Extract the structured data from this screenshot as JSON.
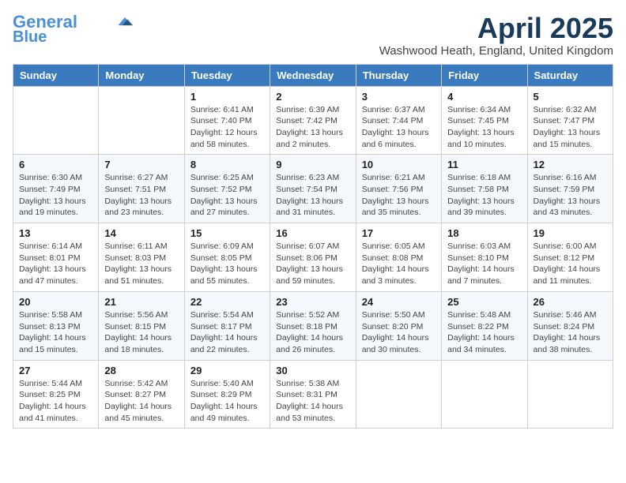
{
  "logo": {
    "line1": "General",
    "line2": "Blue",
    "icon_color": "#4a90d9"
  },
  "header": {
    "month": "April 2025",
    "location": "Washwood Heath, England, United Kingdom"
  },
  "weekdays": [
    "Sunday",
    "Monday",
    "Tuesday",
    "Wednesday",
    "Thursday",
    "Friday",
    "Saturday"
  ],
  "weeks": [
    [
      {
        "day": "",
        "info": ""
      },
      {
        "day": "",
        "info": ""
      },
      {
        "day": "1",
        "info": "Sunrise: 6:41 AM\nSunset: 7:40 PM\nDaylight: 12 hours and 58 minutes."
      },
      {
        "day": "2",
        "info": "Sunrise: 6:39 AM\nSunset: 7:42 PM\nDaylight: 13 hours and 2 minutes."
      },
      {
        "day": "3",
        "info": "Sunrise: 6:37 AM\nSunset: 7:44 PM\nDaylight: 13 hours and 6 minutes."
      },
      {
        "day": "4",
        "info": "Sunrise: 6:34 AM\nSunset: 7:45 PM\nDaylight: 13 hours and 10 minutes."
      },
      {
        "day": "5",
        "info": "Sunrise: 6:32 AM\nSunset: 7:47 PM\nDaylight: 13 hours and 15 minutes."
      }
    ],
    [
      {
        "day": "6",
        "info": "Sunrise: 6:30 AM\nSunset: 7:49 PM\nDaylight: 13 hours and 19 minutes."
      },
      {
        "day": "7",
        "info": "Sunrise: 6:27 AM\nSunset: 7:51 PM\nDaylight: 13 hours and 23 minutes."
      },
      {
        "day": "8",
        "info": "Sunrise: 6:25 AM\nSunset: 7:52 PM\nDaylight: 13 hours and 27 minutes."
      },
      {
        "day": "9",
        "info": "Sunrise: 6:23 AM\nSunset: 7:54 PM\nDaylight: 13 hours and 31 minutes."
      },
      {
        "day": "10",
        "info": "Sunrise: 6:21 AM\nSunset: 7:56 PM\nDaylight: 13 hours and 35 minutes."
      },
      {
        "day": "11",
        "info": "Sunrise: 6:18 AM\nSunset: 7:58 PM\nDaylight: 13 hours and 39 minutes."
      },
      {
        "day": "12",
        "info": "Sunrise: 6:16 AM\nSunset: 7:59 PM\nDaylight: 13 hours and 43 minutes."
      }
    ],
    [
      {
        "day": "13",
        "info": "Sunrise: 6:14 AM\nSunset: 8:01 PM\nDaylight: 13 hours and 47 minutes."
      },
      {
        "day": "14",
        "info": "Sunrise: 6:11 AM\nSunset: 8:03 PM\nDaylight: 13 hours and 51 minutes."
      },
      {
        "day": "15",
        "info": "Sunrise: 6:09 AM\nSunset: 8:05 PM\nDaylight: 13 hours and 55 minutes."
      },
      {
        "day": "16",
        "info": "Sunrise: 6:07 AM\nSunset: 8:06 PM\nDaylight: 13 hours and 59 minutes."
      },
      {
        "day": "17",
        "info": "Sunrise: 6:05 AM\nSunset: 8:08 PM\nDaylight: 14 hours and 3 minutes."
      },
      {
        "day": "18",
        "info": "Sunrise: 6:03 AM\nSunset: 8:10 PM\nDaylight: 14 hours and 7 minutes."
      },
      {
        "day": "19",
        "info": "Sunrise: 6:00 AM\nSunset: 8:12 PM\nDaylight: 14 hours and 11 minutes."
      }
    ],
    [
      {
        "day": "20",
        "info": "Sunrise: 5:58 AM\nSunset: 8:13 PM\nDaylight: 14 hours and 15 minutes."
      },
      {
        "day": "21",
        "info": "Sunrise: 5:56 AM\nSunset: 8:15 PM\nDaylight: 14 hours and 18 minutes."
      },
      {
        "day": "22",
        "info": "Sunrise: 5:54 AM\nSunset: 8:17 PM\nDaylight: 14 hours and 22 minutes."
      },
      {
        "day": "23",
        "info": "Sunrise: 5:52 AM\nSunset: 8:18 PM\nDaylight: 14 hours and 26 minutes."
      },
      {
        "day": "24",
        "info": "Sunrise: 5:50 AM\nSunset: 8:20 PM\nDaylight: 14 hours and 30 minutes."
      },
      {
        "day": "25",
        "info": "Sunrise: 5:48 AM\nSunset: 8:22 PM\nDaylight: 14 hours and 34 minutes."
      },
      {
        "day": "26",
        "info": "Sunrise: 5:46 AM\nSunset: 8:24 PM\nDaylight: 14 hours and 38 minutes."
      }
    ],
    [
      {
        "day": "27",
        "info": "Sunrise: 5:44 AM\nSunset: 8:25 PM\nDaylight: 14 hours and 41 minutes."
      },
      {
        "day": "28",
        "info": "Sunrise: 5:42 AM\nSunset: 8:27 PM\nDaylight: 14 hours and 45 minutes."
      },
      {
        "day": "29",
        "info": "Sunrise: 5:40 AM\nSunset: 8:29 PM\nDaylight: 14 hours and 49 minutes."
      },
      {
        "day": "30",
        "info": "Sunrise: 5:38 AM\nSunset: 8:31 PM\nDaylight: 14 hours and 53 minutes."
      },
      {
        "day": "",
        "info": ""
      },
      {
        "day": "",
        "info": ""
      },
      {
        "day": "",
        "info": ""
      }
    ]
  ]
}
